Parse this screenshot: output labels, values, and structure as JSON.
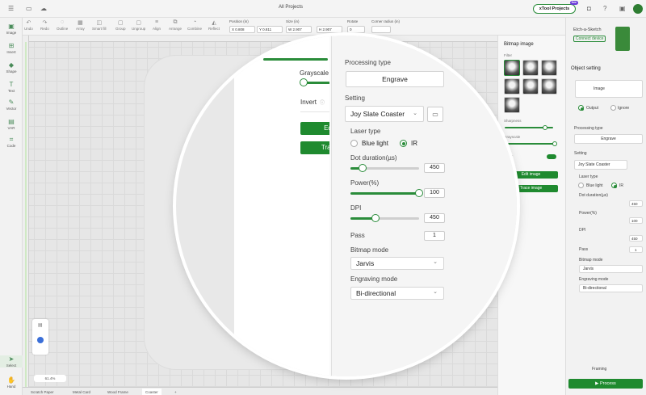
{
  "window": {
    "title": "All Projects"
  },
  "brand": {
    "project_button": "xTool Projects",
    "free_badge": "free",
    "accent": "#1f8a2f"
  },
  "toolbar": {
    "tools": [
      "Undo",
      "Redo",
      "Outline",
      "Array",
      "Smart fill",
      "Group",
      "Ungroup",
      "Align",
      "Arrange",
      "Combine",
      "Reflect"
    ],
    "position_label": "Position (in)",
    "x": "X 0.808",
    "y": "Y 0.811",
    "size_label": "Size (in)",
    "w": "W 2.907",
    "h": "H 2.907",
    "rotate_label": "Rotate",
    "rotate": "0",
    "corner_label": "Corner radius (in)"
  },
  "leftbar": [
    "Image",
    "Insert",
    "Shape",
    "Text",
    "Vector",
    "VAR",
    "Code",
    "Select",
    "Hand"
  ],
  "canvas": {
    "zoom": "61.4%"
  },
  "tabs": [
    "Scratch Paper",
    "Metal Card",
    "Wood Frame",
    "Coaster"
  ],
  "bitmap_panel": {
    "title": "Bitmap image",
    "filter_label": "Filter",
    "sharpness_label": "Sharpness",
    "grayscale_label": "Grayscale",
    "invert_label": "Invert",
    "edit_button": "Edit image",
    "trace_button": "Trace image"
  },
  "right_panel": {
    "device_name": "Etch-a-Sketch",
    "connect_button": "Connect device",
    "object_setting": "Object setting",
    "object_type": "Image",
    "output_label": "Output",
    "ignore_label": "Ignore",
    "processing_type_label": "Processing type",
    "processing_type": "Engrave",
    "setting_label": "Setting",
    "setting_value": "Joy Slate Coaster",
    "laser_type_label": "Laser type",
    "blue_light": "Blue light",
    "ir": "IR",
    "dot_duration_label": "Dot duration(µs)",
    "dot_duration": "450",
    "power_label": "Power(%)",
    "power": "100",
    "dpi_label": "DPI",
    "dpi": "450",
    "pass_label": "Pass",
    "pass": "1",
    "bitmap_mode_label": "Bitmap mode",
    "bitmap_mode": "Jarvis",
    "engraving_mode_label": "Engraving mode",
    "engraving_mode": "Bi-directional",
    "framing_button": "Framing",
    "process_button": "Process"
  },
  "magnifier": {
    "grayscale_label": "Grayscale",
    "invert_label": "Invert",
    "edit_button": "Edit image",
    "trace_button": "Trace image",
    "processing_type_label": "Processing type",
    "processing_type": "Engrave",
    "setting_label": "Setting",
    "setting_value": "Joy Slate Coaster",
    "laser_type_label": "Laser type",
    "blue_light": "Blue light",
    "ir": "IR",
    "dot_duration_label": "Dot duration(µs)",
    "dot_duration": "450",
    "power_label": "Power(%)",
    "power": "100",
    "dpi_label": "DPI",
    "dpi": "450",
    "pass_label": "Pass",
    "pass": "1",
    "bitmap_mode_label": "Bitmap mode",
    "bitmap_mode": "Jarvis",
    "engraving_mode_label": "Engraving mode",
    "engraving_mode": "Bi-directional"
  }
}
